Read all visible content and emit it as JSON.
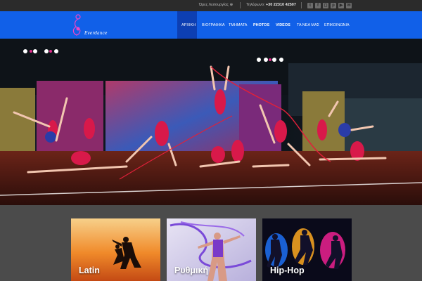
{
  "topbar": {
    "hours_label": "Ώρες Λειτουργίας",
    "phone_prefix": "Τηλέφωνο:",
    "phone_number": "+30 22310 42507",
    "social_icons": [
      "twitter-icon",
      "facebook-icon",
      "instagram-icon",
      "pinterest-icon",
      "youtube-icon",
      "email-icon"
    ]
  },
  "logo": {
    "script_text": "Everdance"
  },
  "nav": {
    "items": [
      {
        "label": "ΑΡΧΙΚΗ",
        "active": true
      },
      {
        "label": "ΒΙΟΓΡΑΦΙΚΑ",
        "active": false
      },
      {
        "label": "ΤΜΗΜΑΤΑ",
        "active": false
      },
      {
        "label": "PHOTOS",
        "active": false
      },
      {
        "label": "VIDEOS",
        "active": false
      },
      {
        "label": "ΤΑ ΝΕΑ ΜΑΣ",
        "active": false
      },
      {
        "label": "ΕΠΙΚΟΙΝΩΝΙΑ",
        "active": false
      }
    ]
  },
  "tiles": [
    {
      "label": "Latin"
    },
    {
      "label": "Ρυθμική"
    },
    {
      "label": "Hip-Hop"
    }
  ],
  "colors": {
    "accent": "#1160e8",
    "topbar": "#2b2b2b",
    "background": "#4b4b4b"
  }
}
